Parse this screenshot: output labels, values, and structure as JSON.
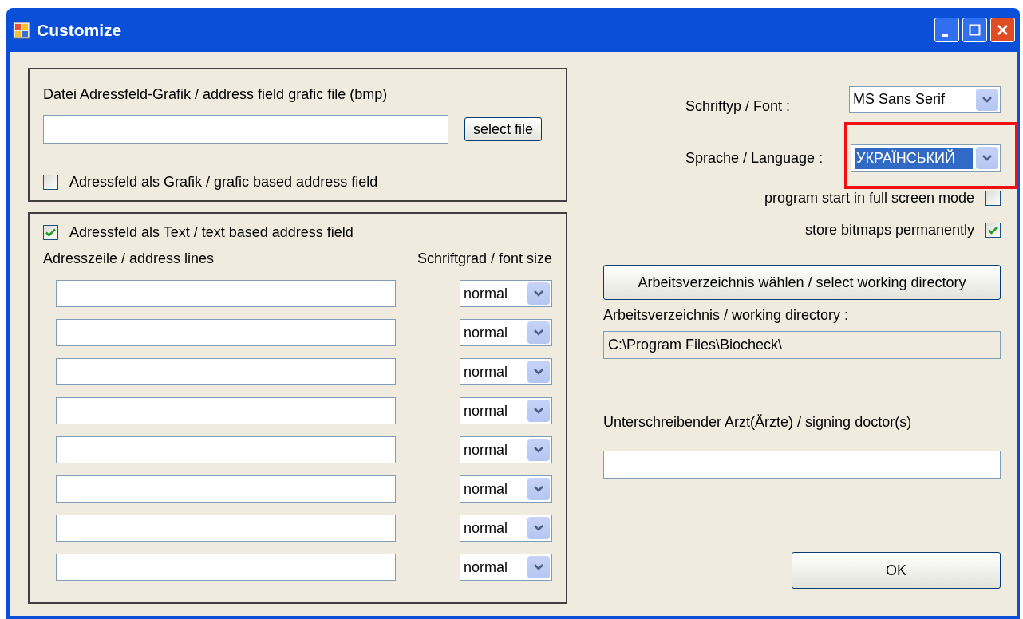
{
  "window": {
    "title": "Customize"
  },
  "graphic_group": {
    "file_label": "Datei Adressfeld-Grafik / address field grafic file (bmp)",
    "select_button": "select file",
    "checkbox": {
      "label": "Adressfeld als Grafik /  grafic based address field",
      "checked": false
    }
  },
  "text_group": {
    "checkbox": {
      "label": "Adressfeld als Text / text based address field",
      "checked": true
    },
    "column_1": "Adresszeile / address lines",
    "column_2": "Schriftgrad / font size",
    "rows": [
      {
        "font_size": "normal"
      },
      {
        "font_size": "normal"
      },
      {
        "font_size": "normal"
      },
      {
        "font_size": "normal"
      },
      {
        "font_size": "normal"
      },
      {
        "font_size": "normal"
      },
      {
        "font_size": "normal"
      },
      {
        "font_size": "normal"
      }
    ]
  },
  "settings": {
    "font_label": "Schriftyp / Font :",
    "font_value": "MS Sans Serif",
    "language_label": "Sprache / Language :",
    "language_value": "УКРАЇНСЬКИЙ",
    "language_text_selected": true,
    "language_highlighted": true,
    "options": [
      {
        "label": "program start in full screen mode",
        "checked": false
      },
      {
        "label": "store bitmaps permanently",
        "checked": true
      }
    ],
    "directory_button": "Arbeitsverzeichnis wählen / select working directory",
    "directory_label": "Arbeitsverzeichnis / working directory :",
    "directory_value": "C:\\Program Files\\Biocheck\\",
    "doctor_label": "Unterschreibender Arzt(Ärzte) / signing doctor(s)",
    "ok_button": "OK"
  }
}
